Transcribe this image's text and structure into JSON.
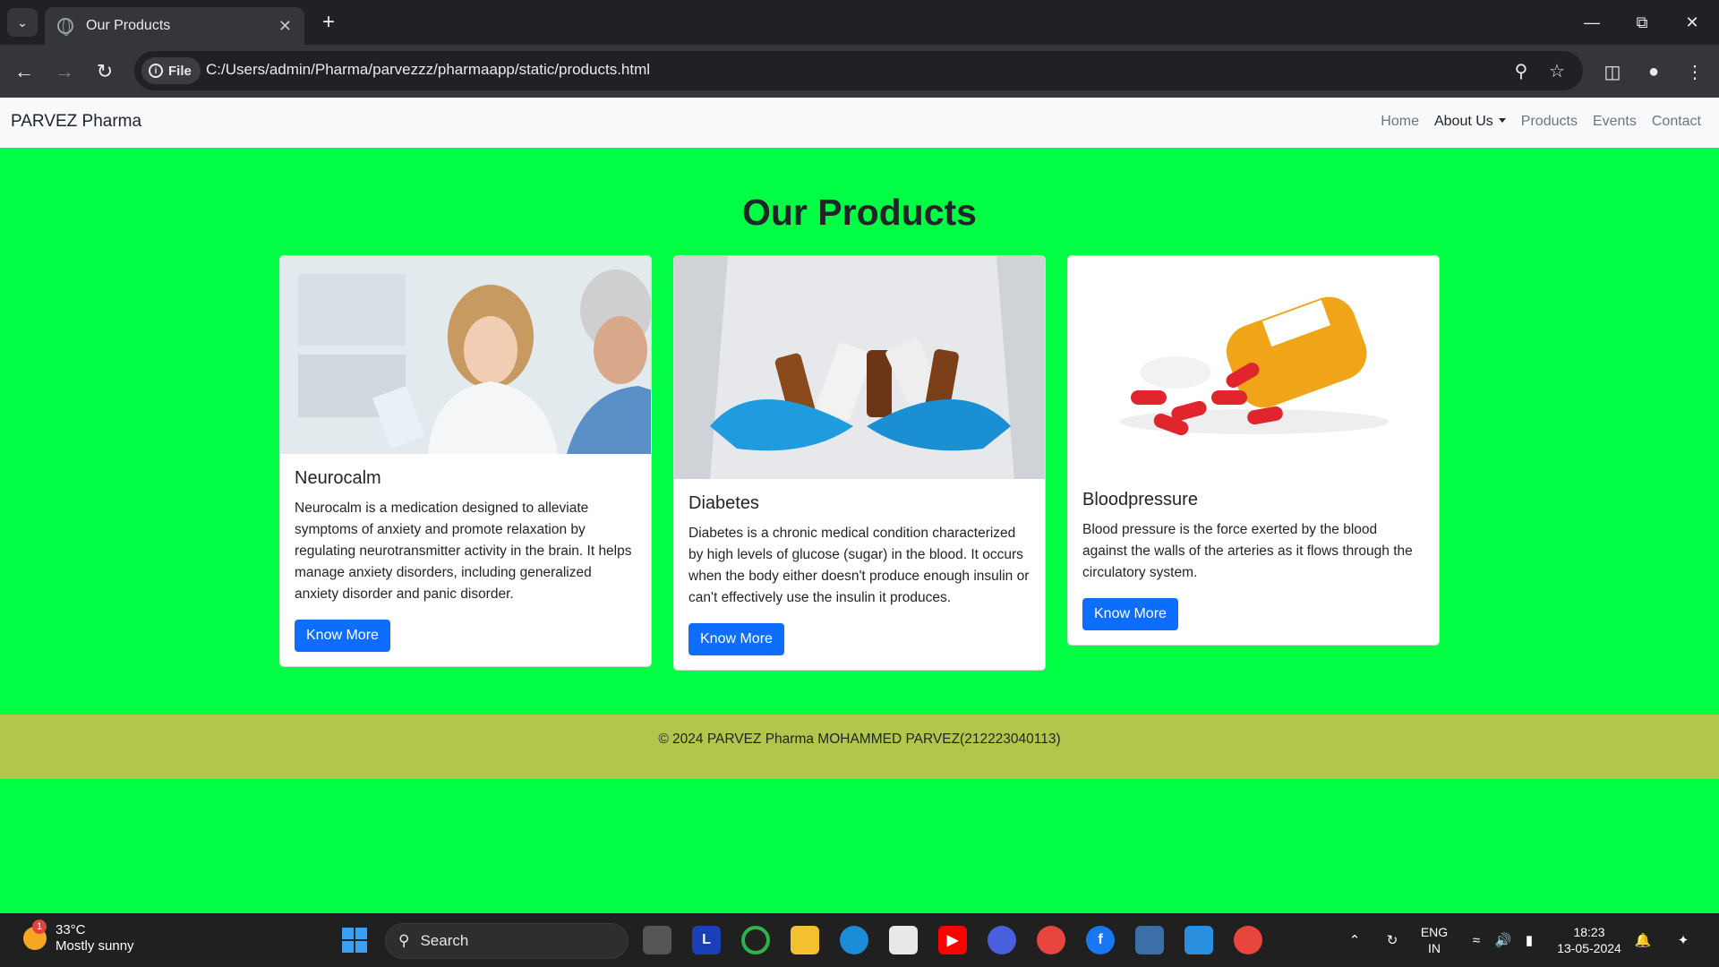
{
  "browser": {
    "tab_title": "Our Products",
    "address_chip": "File",
    "url": "C:/Users/admin/Pharma/parvezzz/pharmaapp/static/products.html"
  },
  "site": {
    "brand": "PARVEZ Pharma",
    "nav": [
      {
        "label": "Home"
      },
      {
        "label": "About Us"
      },
      {
        "label": "Products"
      },
      {
        "label": "Events"
      },
      {
        "label": "Contact"
      }
    ]
  },
  "page": {
    "heading": "Our Products",
    "products": [
      {
        "title": "Neurocalm",
        "description": "Neurocalm is a medication designed to alleviate symptoms of anxiety and promote relaxation by regulating neurotransmitter activity in the brain. It helps manage anxiety disorders, including generalized anxiety disorder and panic disorder.",
        "button": "Know More"
      },
      {
        "title": "Diabetes",
        "description": "Diabetes is a chronic medical condition characterized by high levels of glucose (sugar) in the blood. It occurs when the body either doesn't produce enough insulin or can't effectively use the insulin it produces.",
        "button": "Know More"
      },
      {
        "title": "Bloodpressure",
        "description": "Blood pressure is the force exerted by the blood against the walls of the arteries as it flows through the circulatory system.",
        "button": "Know More"
      }
    ],
    "footer": "© 2024 PARVEZ Pharma MOHAMMED PARVEZ(212223040113)"
  },
  "taskbar": {
    "weather_badge": "1",
    "temperature": "33°C",
    "weather": "Mostly sunny",
    "search_label": "Search",
    "app_letter": "L",
    "lang_line1": "ENG",
    "lang_line2": "IN",
    "time": "18:23",
    "date": "13-05-2024"
  },
  "colors": {
    "page_bg": "#00ff44",
    "footer_bg": "#b2c64c",
    "button": "#0d6efd"
  }
}
